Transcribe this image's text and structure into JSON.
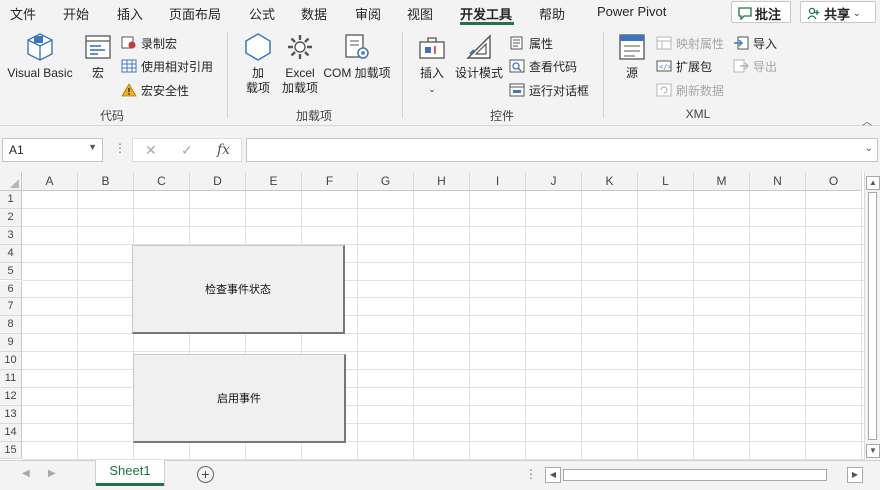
{
  "menu": {
    "tabs": [
      "文件",
      "开始",
      "插入",
      "页面布局",
      "公式",
      "数据",
      "审阅",
      "视图",
      "开发工具",
      "帮助",
      "Power Pivot"
    ],
    "active_tab": "开发工具",
    "comments_label": "批注",
    "share_label": "共享"
  },
  "ribbon": {
    "code": {
      "label": "代码",
      "visual_basic": "Visual Basic",
      "macros": "宏",
      "record_macro": "录制宏",
      "relative_refs": "使用相对引用",
      "macro_security": "宏安全性"
    },
    "addins": {
      "label": "加载项",
      "addins_line1": "加",
      "addins_line2": "载项",
      "excel_addins_line1": "Excel",
      "excel_addins_line2": "加载项",
      "com_addins": "COM 加载项"
    },
    "controls": {
      "label": "控件",
      "insert": "插入",
      "design_mode": "设计模式",
      "properties": "属性",
      "view_code": "查看代码",
      "run_dialog": "运行对话框"
    },
    "xml": {
      "label": "XML",
      "source": "源",
      "map_properties": "映射属性",
      "expansion_packs": "扩展包",
      "refresh_data": "刷新数据",
      "import": "导入",
      "export": "导出"
    }
  },
  "formula_bar": {
    "name_box": "A1",
    "formula": "",
    "fx_label": "fx"
  },
  "sheet": {
    "columns": [
      "A",
      "B",
      "C",
      "D",
      "E",
      "F",
      "G",
      "H",
      "I",
      "J",
      "K",
      "L",
      "M",
      "N",
      "O"
    ],
    "rows": [
      "1",
      "2",
      "3",
      "4",
      "5",
      "6",
      "7",
      "8",
      "9",
      "10",
      "11",
      "12",
      "13",
      "14",
      "15"
    ],
    "buttons": {
      "check_events": "检查事件状态",
      "enable_events": "启用事件"
    }
  },
  "sheet_tabs": {
    "active": "Sheet1"
  },
  "colors": {
    "accent": "#217346",
    "ribbon_bg": "#f3f3f3",
    "gridline": "#e1e1e1"
  }
}
